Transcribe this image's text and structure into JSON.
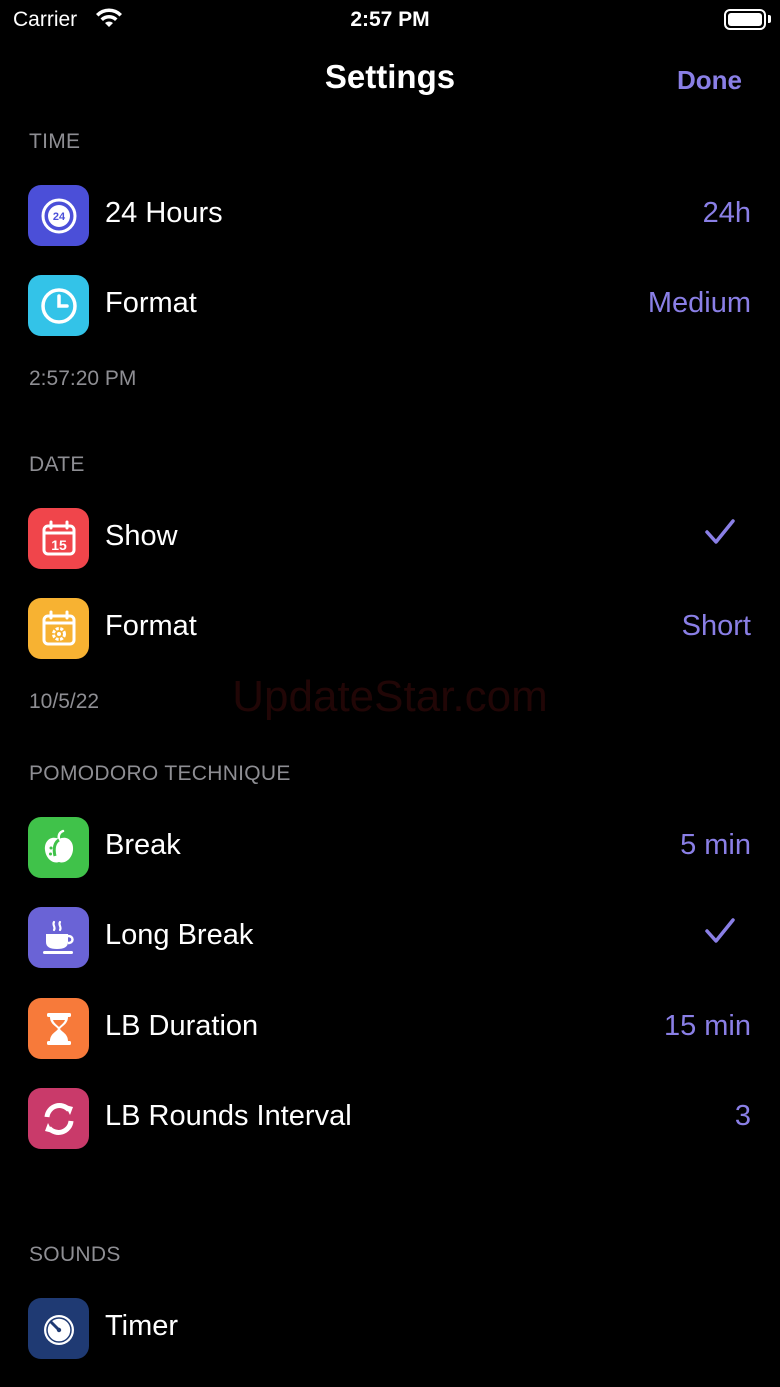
{
  "status_bar": {
    "carrier": "Carrier",
    "time": "2:57 PM"
  },
  "nav": {
    "title": "Settings",
    "done_label": "Done"
  },
  "time_section": {
    "header": "TIME",
    "rows": [
      {
        "label": "24 Hours",
        "value": "24h",
        "icon": "24-hour-icon",
        "icon_color": "#4b4fd8"
      },
      {
        "label": "Format",
        "value": "Medium",
        "icon": "clock-icon",
        "icon_color": "#33c3e8"
      }
    ],
    "footer": "2:57:20 PM"
  },
  "date_section": {
    "header": "DATE",
    "rows": [
      {
        "label": "Show",
        "checked": true,
        "icon": "calendar-15-icon",
        "icon_color": "#f0454b"
      },
      {
        "label": "Format",
        "value": "Short",
        "icon": "calendar-gear-icon",
        "icon_color": "#f7b232"
      }
    ],
    "footer": "10/5/22"
  },
  "pomodoro_section": {
    "header": "POMODORO TECHNIQUE",
    "rows": [
      {
        "label": "Break",
        "value": "5 min",
        "icon": "apple-icon",
        "icon_color": "#40c24a"
      },
      {
        "label": "Long Break",
        "checked": true,
        "icon": "coffee-cup-icon",
        "icon_color": "#6a63d6"
      },
      {
        "label": "LB Duration",
        "value": "15 min",
        "icon": "hourglass-icon",
        "icon_color": "#f77a3a"
      },
      {
        "label": "LB Rounds Interval",
        "value": "3",
        "icon": "cycle-arrows-icon",
        "icon_color": "#c93a6a"
      }
    ]
  },
  "sounds_section": {
    "header": "SOUNDS",
    "rows": [
      {
        "label": "Timer",
        "icon": "stopwatch-icon",
        "icon_color": "#1f3a73"
      }
    ]
  },
  "watermark": "UpdateStar.com",
  "accent_color": "#8a7fe6"
}
